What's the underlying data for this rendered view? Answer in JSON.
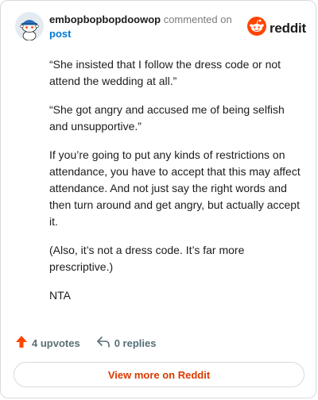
{
  "comment": {
    "author": "embopbopbopdoowop",
    "action_text": "commented on",
    "post_link": "post",
    "paragraphs": [
      "“She insisted that I follow the dress code or not attend the wedding at all.”",
      "“She got angry and accused me of being selfish and unsupportive.”",
      "If you’re going to put any kinds of restrictions on attendance, you have to accept that this may affect attendance. And not just say the right words and then turn around and get angry, but actually accept it.",
      "(Also, it’s not a dress code. It’s far more prescriptive.)",
      "NTA"
    ]
  },
  "brand": {
    "name": "reddit",
    "color": "#ff4500"
  },
  "stats": {
    "upvotes": "4 upvotes",
    "replies": "0 replies",
    "upvote_icon": "upvote-arrow-icon",
    "reply_icon": "reply-arrow-icon"
  },
  "footer": {
    "view_more": "View more on Reddit"
  },
  "colors": {
    "link": "#0079d3",
    "accent": "#d93a00",
    "muted": "#7c7c7c",
    "border": "#d7dadc"
  }
}
